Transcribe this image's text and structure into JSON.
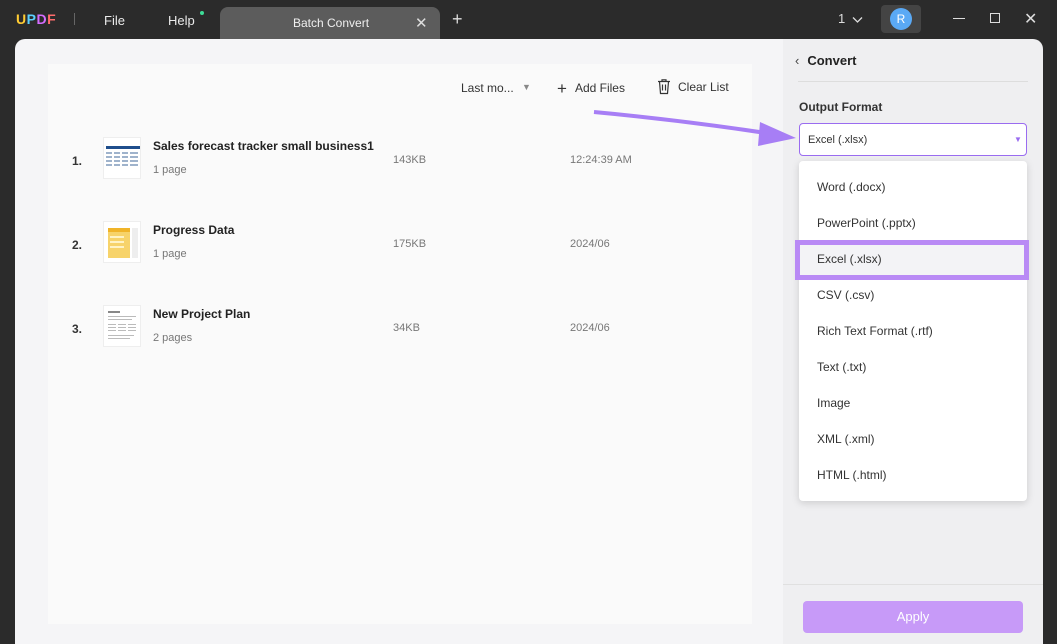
{
  "titlebar": {
    "logo": "UPDF",
    "menu_file": "File",
    "menu_help": "Help",
    "tab_title": "Batch Convert",
    "tab_close": "✕",
    "new_tab": "+",
    "page_count": "1",
    "avatar_letter": "R",
    "window_close": "✕"
  },
  "toolbar": {
    "sort_label": "Last mo...",
    "add_files": "Add Files",
    "clear_list": "Clear List"
  },
  "files": [
    {
      "num": "1.",
      "name": "Sales forecast tracker small business1",
      "pages": "1 page",
      "size": "143KB",
      "date": "12:24:39 AM"
    },
    {
      "num": "2.",
      "name": "Progress Data",
      "pages": "1 page",
      "size": "175KB",
      "date": "2024/06"
    },
    {
      "num": "3.",
      "name": "New Project Plan",
      "pages": "2 pages",
      "size": "34KB",
      "date": "2024/06"
    }
  ],
  "panel": {
    "back_icon": "‹",
    "title": "Convert",
    "output_format_label": "Output Format",
    "selected_format": "Excel (.xlsx)",
    "options": [
      "Word (.docx)",
      "PowerPoint (.pptx)",
      "Excel (.xlsx)",
      "CSV (.csv)",
      "Rich Text Format (.rtf)",
      "Text (.txt)",
      "Image",
      "XML (.xml)",
      "HTML (.html)"
    ],
    "apply": "Apply"
  },
  "colors": {
    "accent": "#9a6cf0",
    "highlight": "#b98af5",
    "apply_button": "#c79af8"
  }
}
